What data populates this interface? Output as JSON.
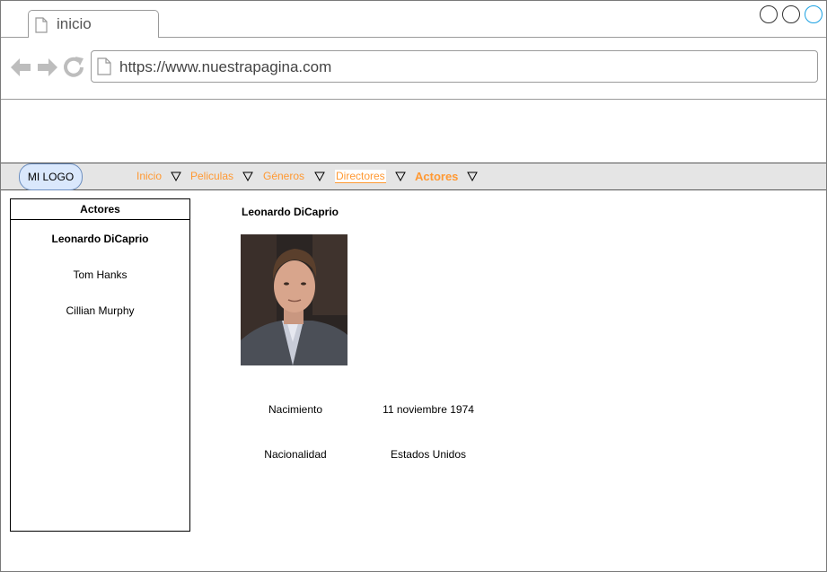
{
  "browser": {
    "tab_title": "inicio",
    "url": "https://www.nuestrapagina.com"
  },
  "navbar": {
    "logo": "MI LOGO",
    "items": [
      {
        "label": "Inicio"
      },
      {
        "label": "Peliculas"
      },
      {
        "label": "Géneros"
      },
      {
        "label": "Directores"
      },
      {
        "label": "Actores"
      }
    ]
  },
  "sidebar": {
    "title": "Actores",
    "items": [
      {
        "label": "Leonardo DiCaprio",
        "selected": true
      },
      {
        "label": "Tom Hanks"
      },
      {
        "label": "Cillian Murphy"
      }
    ]
  },
  "detail": {
    "name": "Leonardo DiCaprio",
    "fields": [
      {
        "label": "Nacimiento",
        "value": "11 noviembre 1974"
      },
      {
        "label": "Nacionalidad",
        "value": "Estados Unidos"
      }
    ]
  },
  "colors": {
    "accent": "#ff9933",
    "nav_bg": "#e5e5e5",
    "logo_bg": "#dae8fc",
    "close_button": "#1ba1e2"
  }
}
